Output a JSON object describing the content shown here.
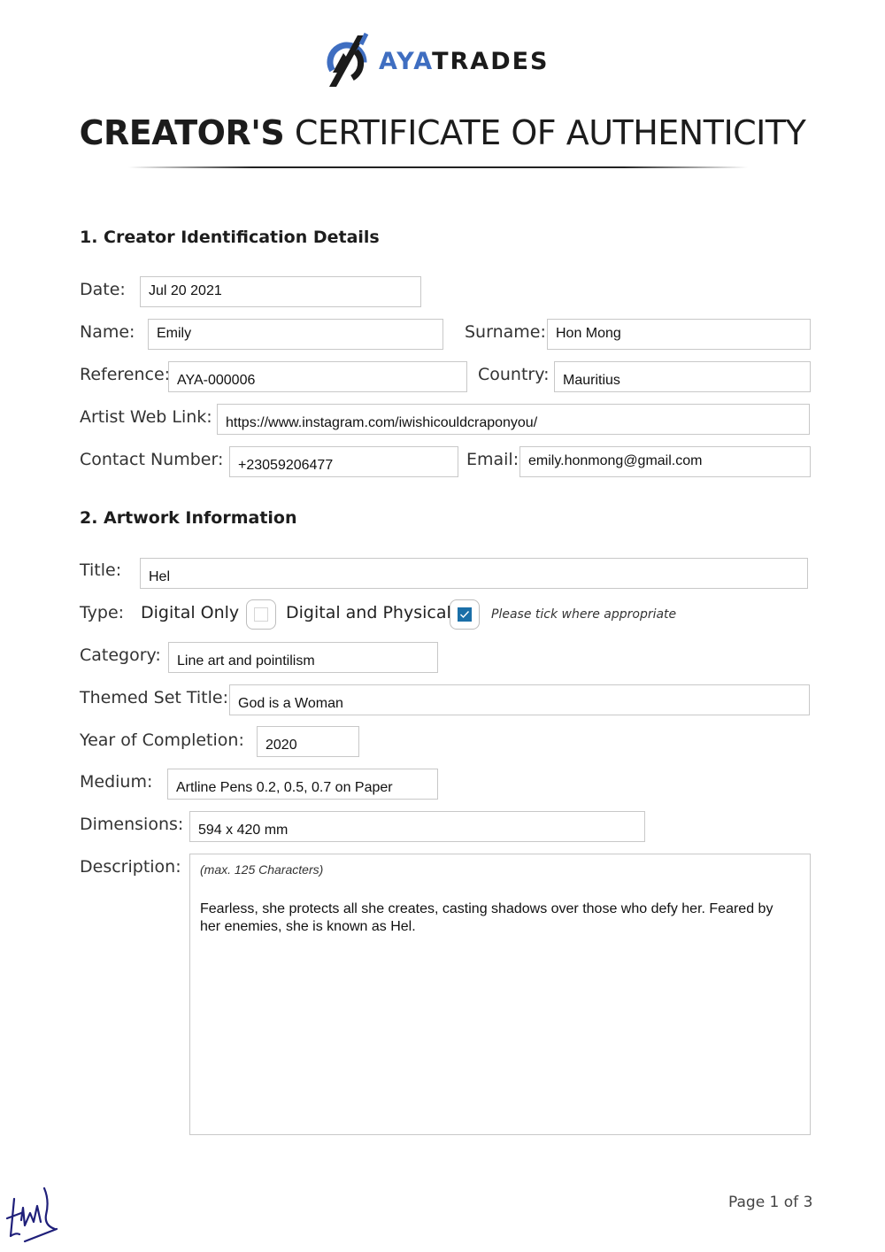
{
  "brand": {
    "name_part1": "AYA",
    "name_part2": "TRADES",
    "accent_color": "#3f6ec1"
  },
  "certificate": {
    "title_bold": "CREATOR'S",
    "title_light": "CERTIFICATE OF AUTHENTICITY"
  },
  "section1": {
    "heading": "1. Creator Identification Details",
    "fields": {
      "date": {
        "label": "Date:",
        "value": "Jul 20 2021"
      },
      "name": {
        "label": "Name:",
        "value": "Emily"
      },
      "surname": {
        "label": "Surname:",
        "value": "Hon Mong"
      },
      "reference": {
        "label": "Reference:",
        "value": "AYA-000006"
      },
      "country": {
        "label": "Country:",
        "value": "Mauritius"
      },
      "web_link": {
        "label": "Artist Web Link:",
        "value": "https://www.instagram.com/iwishicouldcraponyou/"
      },
      "contact": {
        "label": "Contact Number:",
        "value": "+23059206477"
      },
      "email": {
        "label": "Email:",
        "value": "emily.honmong@gmail.com"
      }
    }
  },
  "section2": {
    "heading": "2. Artwork Information",
    "fields": {
      "title": {
        "label": "Title:",
        "value": "Hel"
      },
      "type": {
        "label": "Type:",
        "options": [
          {
            "label": "Digital Only",
            "checked": false
          },
          {
            "label": "Digital and Physical",
            "checked": true
          }
        ],
        "hint": "Please tick where appropriate"
      },
      "category": {
        "label": "Category:",
        "value": "Line art and pointilism"
      },
      "themed_set": {
        "label": "Themed Set Title:",
        "value": "God is a Woman"
      },
      "year": {
        "label": "Year of Completion:",
        "value": "2020"
      },
      "medium": {
        "label": "Medium:",
        "value": "Artline Pens 0.2, 0.5, 0.7 on Paper"
      },
      "dimensions": {
        "label": "Dimensions:",
        "value": "594 x 420 mm"
      },
      "description": {
        "label": "Description:",
        "hint": "(max. 125 Characters)",
        "value": "Fearless, she protects all she creates, casting shadows over those who defy her. Feared by her enemies, she is known as Hel."
      }
    }
  },
  "footer": {
    "page_label": "Page 1 of 3",
    "signature_color": "#1f1f7a"
  }
}
